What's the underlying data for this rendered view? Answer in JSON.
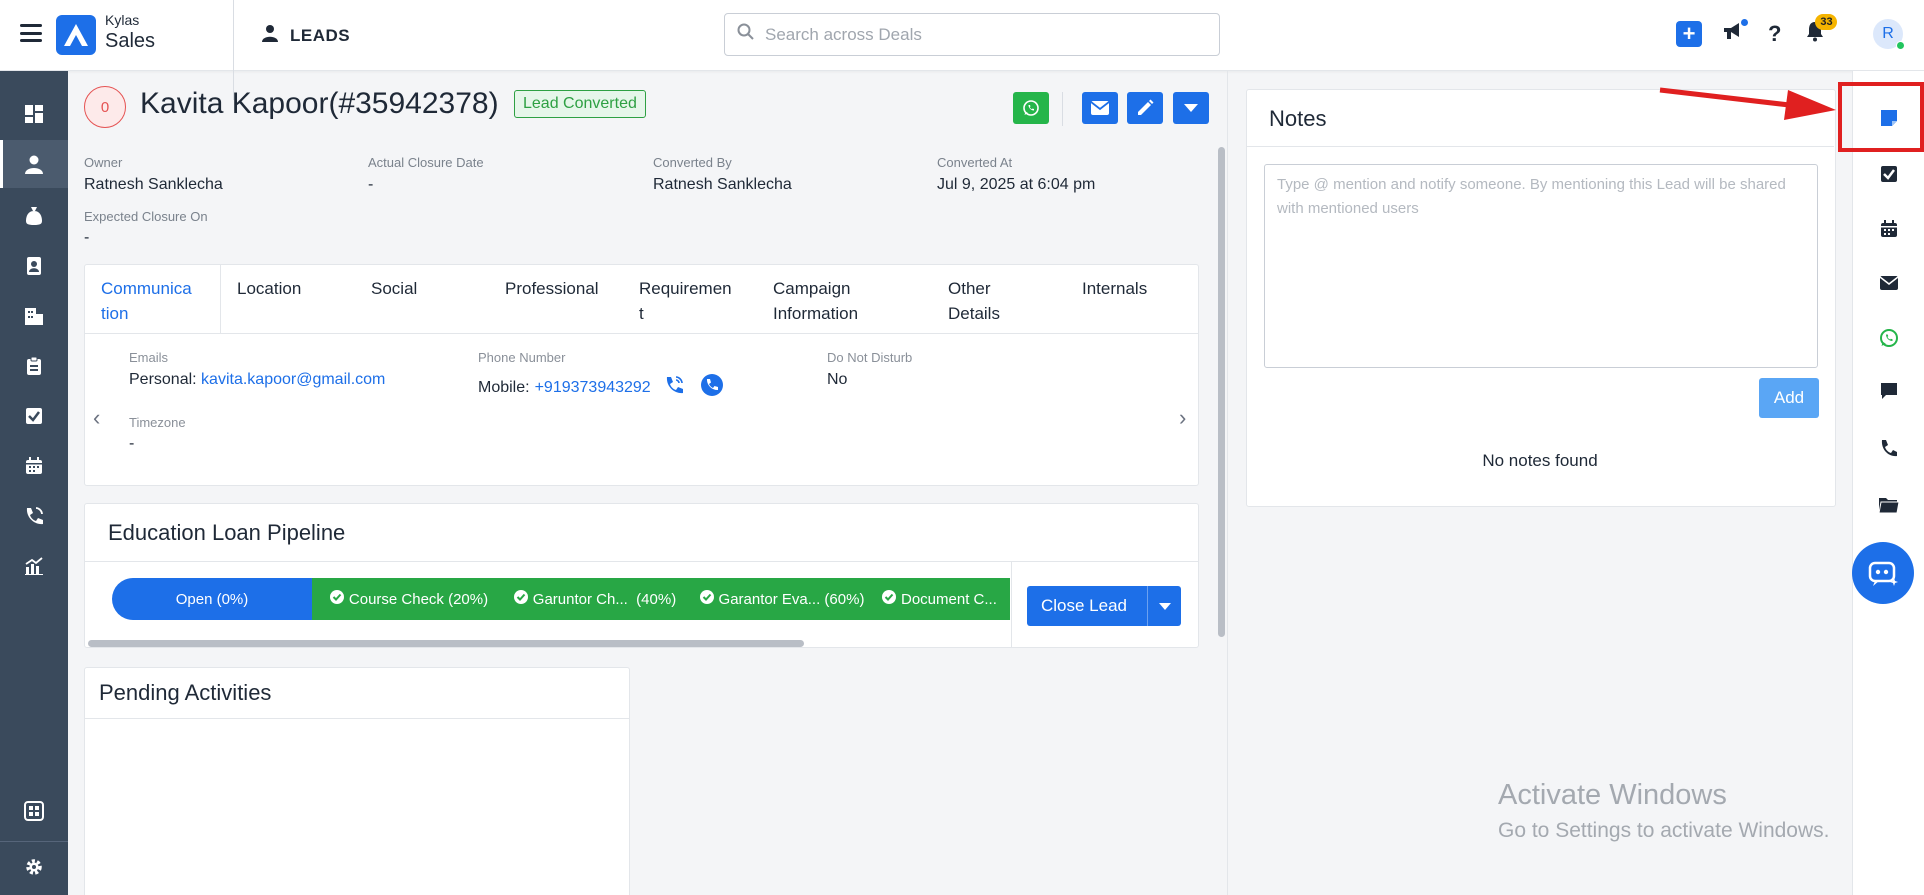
{
  "app": {
    "brand_top": "Kylas",
    "brand_bottom": "Sales",
    "module": "LEADS"
  },
  "search": {
    "placeholder": "Search across Deals"
  },
  "header": {
    "notification_count": "33",
    "avatar_initial": "R"
  },
  "left_nav": [
    "dashboard-icon",
    "leads-icon",
    "deals-icon",
    "contacts-icon",
    "companies-icon",
    "products-icon",
    "tasks-icon",
    "meetings-icon",
    "calls-icon",
    "reports-icon",
    "apps-icon",
    "settings-icon"
  ],
  "right_rail": [
    "notes-icon",
    "tasks-icon",
    "calendar-icon",
    "email-icon",
    "whatsapp-icon",
    "chat-icon",
    "phone-icon",
    "folder-icon"
  ],
  "lead": {
    "score": "0",
    "title": "Kavita Kapoor(#35942378)",
    "status": "Lead Converted",
    "fields": {
      "owner_label": "Owner",
      "owner": "Ratnesh Sanklecha",
      "actual_closure_label": "Actual Closure Date",
      "actual_closure": "-",
      "converted_by_label": "Converted By",
      "converted_by": "Ratnesh Sanklecha",
      "converted_at_label": "Converted At",
      "converted_at": "Jul 9, 2025 at 6:04 pm",
      "expected_closure_label": "Expected Closure On",
      "expected_closure": "-"
    }
  },
  "tabs": [
    {
      "line1": "Communica",
      "line2": "tion"
    },
    {
      "line1": "Location",
      "line2": ""
    },
    {
      "line1": "Social",
      "line2": ""
    },
    {
      "line1": "Professional",
      "line2": ""
    },
    {
      "line1": "Requiremen",
      "line2": "t"
    },
    {
      "line1": "Campaign",
      "line2": "Information"
    },
    {
      "line1": "Other",
      "line2": "Details"
    },
    {
      "line1": "Internals",
      "line2": ""
    }
  ],
  "communication": {
    "emails_label": "Emails",
    "email_prefix": "Personal:",
    "email": "kavita.kapoor@gmail.com",
    "phone_label": "Phone Number",
    "phone_prefix": "Mobile:",
    "phone": "+919373943292",
    "dnd_label": "Do Not Disturb",
    "dnd": "No",
    "timezone_label": "Timezone",
    "timezone": "-"
  },
  "pipeline": {
    "title": "Education Loan Pipeline",
    "stages": [
      {
        "label": "Open (0%)",
        "state": "current"
      },
      {
        "label": "Course Check (20%)",
        "state": "done"
      },
      {
        "label": "Garuntor Ch...  (40%)",
        "state": "done"
      },
      {
        "label": "Garantor Eva... (60%)",
        "state": "done"
      },
      {
        "label": "Document C...",
        "state": "done"
      }
    ],
    "close_label": "Close Lead"
  },
  "pending": {
    "title": "Pending Activities"
  },
  "notes": {
    "title": "Notes",
    "placeholder": "Type @ mention and notify someone. By mentioning this Lead will be shared with mentioned users",
    "add_label": "Add",
    "empty": "No notes found"
  },
  "watermark": {
    "title": "Activate Windows",
    "subtitle": "Go to Settings to activate Windows."
  },
  "colors": {
    "primary": "#1d6fe8",
    "success": "#2ea043",
    "stage_done": "#28a745",
    "nav_bg": "#3a4a5c",
    "highlight": "#e02020"
  }
}
